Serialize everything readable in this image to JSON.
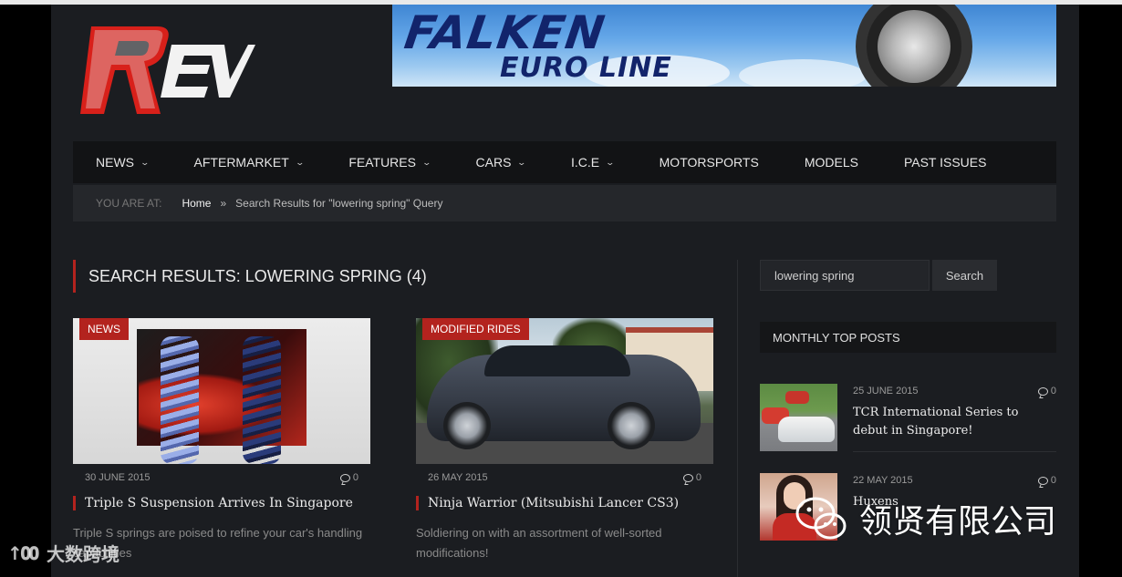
{
  "logo": {
    "text": "REV"
  },
  "banner": {
    "brand": "FALKEN",
    "line": "EURO LINE"
  },
  "nav": {
    "items": [
      {
        "label": "NEWS",
        "has_dropdown": true
      },
      {
        "label": "AFTERMARKET",
        "has_dropdown": true
      },
      {
        "label": "FEATURES",
        "has_dropdown": true
      },
      {
        "label": "CARS",
        "has_dropdown": true
      },
      {
        "label": "I.C.E",
        "has_dropdown": true
      },
      {
        "label": "MOTORSPORTS",
        "has_dropdown": false
      },
      {
        "label": "MODELS",
        "has_dropdown": false
      },
      {
        "label": "PAST ISSUES",
        "has_dropdown": false
      }
    ]
  },
  "breadcrumb": {
    "label": "YOU ARE AT:",
    "home": "Home",
    "separator": "»",
    "current": "Search Results for \"lowering spring\" Query"
  },
  "results": {
    "title": "SEARCH RESULTS: LOWERING SPRING (4)",
    "posts": [
      {
        "category": "NEWS",
        "date": "30 JUNE 2015",
        "comments": "0",
        "title": "Triple S Suspension Arrives In Singapore",
        "excerpt": "Triple S springs are poised to refine your car's handling capabilities"
      },
      {
        "category": "MODIFIED RIDES",
        "date": "26 MAY 2015",
        "comments": "0",
        "title": "Ninja Warrior (Mitsubishi Lancer CS3)",
        "excerpt": "Soldiering on with an assortment of well-sorted modifications!"
      }
    ]
  },
  "sidebar": {
    "search": {
      "value": "lowering spring",
      "button": "Search"
    },
    "widget_title": "MONTHLY TOP POSTS",
    "posts": [
      {
        "date": "25 JUNE 2015",
        "comments": "0",
        "title": "TCR International Series to debut in Singapore!"
      },
      {
        "date": "22 MAY 2015",
        "comments": "0",
        "title": "Huxens"
      }
    ]
  },
  "watermarks": {
    "right": "领贤有限公司",
    "left": "大数跨境"
  },
  "colors": {
    "accent": "#b3231e",
    "background": "#1b1d21",
    "nav_bg": "#121315"
  }
}
